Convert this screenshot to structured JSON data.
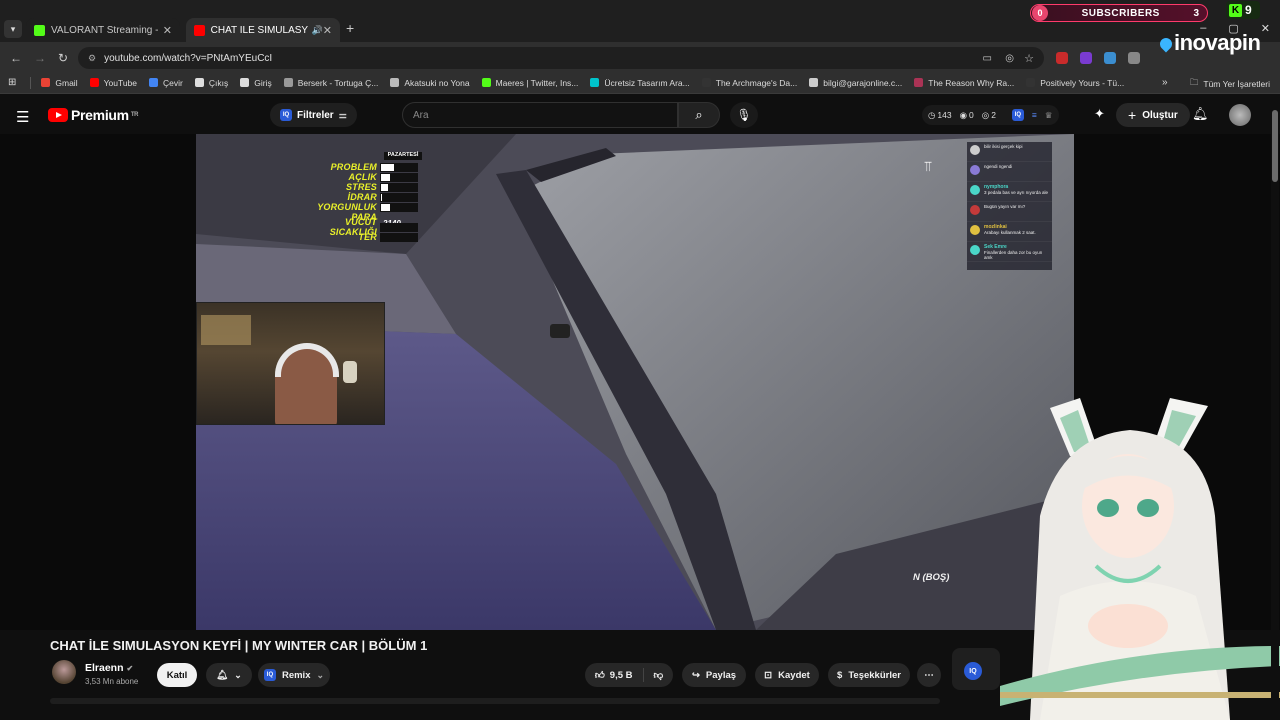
{
  "browser": {
    "tabs": [
      {
        "label": "VALORANT Streaming - Live St",
        "favicon_color": "#53fc18"
      },
      {
        "label": "CHAT İLE SIMULASYON KEYF",
        "favicon_color": "#ff0000"
      }
    ],
    "new_tab": "+",
    "url": "youtube.com/watch?v=PNtAmYEuCcI",
    "window_controls": [
      "–",
      "▢",
      "✕"
    ]
  },
  "stream_overlay": {
    "subscribers_count_left": "0",
    "subscribers_label": "SUBSCRIBERS",
    "subscribers_count_right": "3",
    "kick_badge": "K",
    "kick_count": "9",
    "brand": "inovapin"
  },
  "bookmarks": {
    "items": [
      {
        "label": "Gmail",
        "color": "#ea4335"
      },
      {
        "label": "YouTube",
        "color": "#ff0000"
      },
      {
        "label": "Çevir",
        "color": "#4285f4"
      },
      {
        "label": "Çıkış",
        "color": "#dddddd"
      },
      {
        "label": "Giriş",
        "color": "#dddddd"
      },
      {
        "label": "Berserk - Tortuga Ç...",
        "color": "#999999"
      },
      {
        "label": "Akatsuki no Yona",
        "color": "#bbbbbb"
      },
      {
        "label": "Maeres | Twitter, Ins...",
        "color": "#53fc18"
      },
      {
        "label": "Ücretsiz Tasarım Ara...",
        "color": "#00c4cc"
      },
      {
        "label": "The Archmage's Da...",
        "color": "#333333"
      },
      {
        "label": "bilgi@garajonline.c...",
        "color": "#cccccc"
      },
      {
        "label": "The Reason Why Ra...",
        "color": "#aa3355"
      },
      {
        "label": "Positively Yours - Tü...",
        "color": "#333333"
      }
    ],
    "more": "»",
    "all_bookmarks": "Tüm Yer İşaretleri"
  },
  "youtube_header": {
    "logo_text": "Premium",
    "logo_sup": "TR",
    "filters_label": "Filtreler",
    "filters_badge": "IQ",
    "search_placeholder": "Ara",
    "stats": {
      "time": "143",
      "views": "0",
      "other": "2"
    },
    "create_label": "Oluştur"
  },
  "game_hud": {
    "day": "PAZARTESİ",
    "rows": [
      {
        "label": "PROBLEM",
        "level": 0.35
      },
      {
        "label": "AÇLIK",
        "level": 0.25
      },
      {
        "label": "STRES",
        "level": 0.2
      },
      {
        "label": "İDRAR",
        "level": 0.02
      },
      {
        "label": "YORGUNLUK",
        "level": 0.25
      },
      {
        "label": "PARA",
        "value": "2140"
      },
      {
        "label": "VÜCUT SICAKLIĞI",
        "level": 0
      },
      {
        "label": "TER",
        "level": 0
      }
    ],
    "gear_text": "N (BOŞ)"
  },
  "video_chat": [
    {
      "name": "",
      "text": "bilir ikisi gerçek kipi",
      "color": "#cccccc"
    },
    {
      "name": "",
      "text": "ngendi ngendi",
      "color": "#8a7bd6"
    },
    {
      "name": "nymphora",
      "text": "3 pedala bas ve ayrı nıyorda ale",
      "color": "#4ad6c8"
    },
    {
      "name": "",
      "text": "Bugün yayın var mı?",
      "color": "#c43a3a"
    },
    {
      "name": "mozlinkai",
      "text": "Arabayı kullanmak 2 saat.",
      "color": "#e0c040"
    },
    {
      "name": "Sek Emre",
      "text": "Finallerden daha zor bu oyun amk",
      "color": "#4ad6c8"
    }
  ],
  "video": {
    "title": "CHAT İLE SIMULASYON KEYFİ | MY WINTER CAR | BÖLÜM 1",
    "channel_name": "Elraenn",
    "subscribers": "3,53 Mn abone",
    "join_label": "Katıl",
    "remix_label": "Remix",
    "remix_badge": "IQ",
    "likes": "9,5 B",
    "share_label": "Paylaş",
    "save_label": "Kaydet",
    "thanks_label": "Teşekkürler",
    "side_badge": "IQ"
  }
}
